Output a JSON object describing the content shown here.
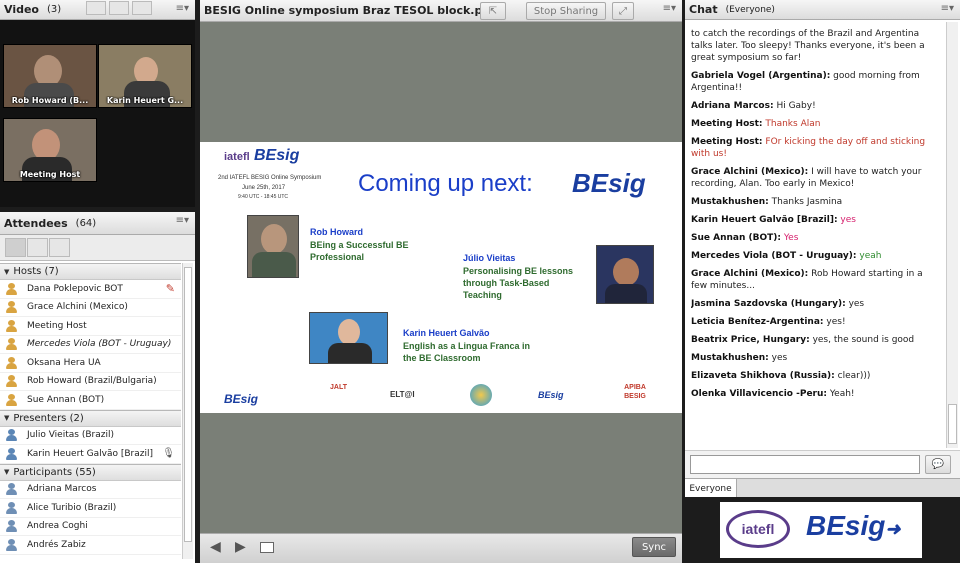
{
  "video": {
    "title": "Video",
    "count": "(3)",
    "participants": [
      {
        "name": "Rob Howard (B..."
      },
      {
        "name": "Karin Heuert G..."
      },
      {
        "name": "Meeting Host"
      }
    ]
  },
  "share": {
    "title": "BESIG Online symposium Braz TESOL block.pptx",
    "stop_sharing_label": "Stop Sharing",
    "sync_label": "Sync"
  },
  "slide": {
    "logo_org": "iatefl",
    "logo_besig": "BEsig",
    "event_title": "2nd IATEFL BESIG Online Symposium",
    "event_date": "June 25th, 2017",
    "event_time": "9:40 UTC - 18:45 UTC",
    "heading": "Coming up next:",
    "speakers": [
      {
        "name": "Rob Howard",
        "topic_line1": "BEing a Successful BE",
        "topic_line2": "Professional",
        "topic_line3": ""
      },
      {
        "name": "Júlio Vieitas",
        "topic_line1": "Personalising BE lessons",
        "topic_line2": "through Task-Based",
        "topic_line3": "Teaching"
      },
      {
        "name": "Karin Heuert Galvão",
        "topic_line1": "English as a Lingua Franca in",
        "topic_line2": "the BE Classroom",
        "topic_line3": ""
      }
    ],
    "sponsors": [
      "BEsig",
      "JALT",
      "ELT@I",
      "",
      "BEsig",
      "APIBA BESIG"
    ]
  },
  "attendees": {
    "title": "Attendees",
    "count": "(64)",
    "hosts_label": "Hosts (7)",
    "hosts": [
      {
        "name": "Dana Poklepovic BOT",
        "italic": false
      },
      {
        "name": "Grace Alchini (Mexico)",
        "italic": false
      },
      {
        "name": "Meeting Host",
        "italic": false
      },
      {
        "name": "Mercedes Viola (BOT - Uruguay)",
        "italic": true
      },
      {
        "name": "Oksana Hera UA",
        "italic": false
      },
      {
        "name": "Rob Howard (Brazil/Bulgaria)",
        "italic": false
      },
      {
        "name": "Sue Annan (BOT)",
        "italic": false
      }
    ],
    "presenters_label": "Presenters (2)",
    "presenters": [
      {
        "name": "Julio Vieitas (Brazil)"
      },
      {
        "name": "Karin Heuert Galvão [Brazil]"
      }
    ],
    "participants_label": "Participants (55)",
    "participants": [
      {
        "name": "Adriana Marcos"
      },
      {
        "name": "Alice Turibio (Brazil)"
      },
      {
        "name": "Andrea Coghi"
      },
      {
        "name": "Andrés Zabiz"
      }
    ]
  },
  "chat": {
    "title": "Chat",
    "scope": "(Everyone)",
    "tab_label": "Everyone",
    "messages": [
      {
        "sender": "",
        "text": "to catch the recordings of the Brazil and Argentina talks later. Too sleepy! Thanks everyone, it's been a great symposium so far!",
        "style": ""
      },
      {
        "sender": "Gabriela Vogel (Argentina):",
        "text": "good morning from Argentina!!",
        "style": ""
      },
      {
        "sender": "Adriana Marcos:",
        "text": "Hi Gaby!",
        "style": ""
      },
      {
        "sender": "Meeting Host:",
        "text": "Thanks Alan",
        "style": "red"
      },
      {
        "sender": "Meeting Host:",
        "text": "FOr kicking the day off and sticking with us!",
        "style": "red"
      },
      {
        "sender": "Grace Alchini (Mexico):",
        "text": "I will have to watch your recording, Alan. Too early in Mexico!",
        "style": ""
      },
      {
        "sender": "Mustakhushen:",
        "text": "Thanks Jasmina",
        "style": ""
      },
      {
        "sender": "Karin Heuert Galvão [Brazil]:",
        "text": "yes",
        "style": "mag"
      },
      {
        "sender": "Sue Annan (BOT):",
        "text": "Yes",
        "style": "mag"
      },
      {
        "sender": "Mercedes Viola (BOT - Uruguay):",
        "text": "yeah",
        "style": "grn"
      },
      {
        "sender": "Grace Alchini (Mexico):",
        "text": "Rob Howard starting in a few minutes...",
        "style": ""
      },
      {
        "sender": "Jasmina Sazdovska (Hungary):",
        "text": "yes",
        "style": ""
      },
      {
        "sender": "Leticia Benítez-Argentina:",
        "text": "yes!",
        "style": ""
      },
      {
        "sender": "Beatrix Price, Hungary:",
        "text": "yes, the sound is good",
        "style": ""
      },
      {
        "sender": "Mustakhushen:",
        "text": "yes",
        "style": ""
      },
      {
        "sender": "Elizaveta Shikhova (Russia):",
        "text": "clear)))",
        "style": ""
      },
      {
        "sender": "Olenka Villavicencio -Peru:",
        "text": "Yeah!",
        "style": ""
      }
    ],
    "input_value": ""
  },
  "footer_logo": {
    "org": "iatefl",
    "brand": "BEsig"
  }
}
